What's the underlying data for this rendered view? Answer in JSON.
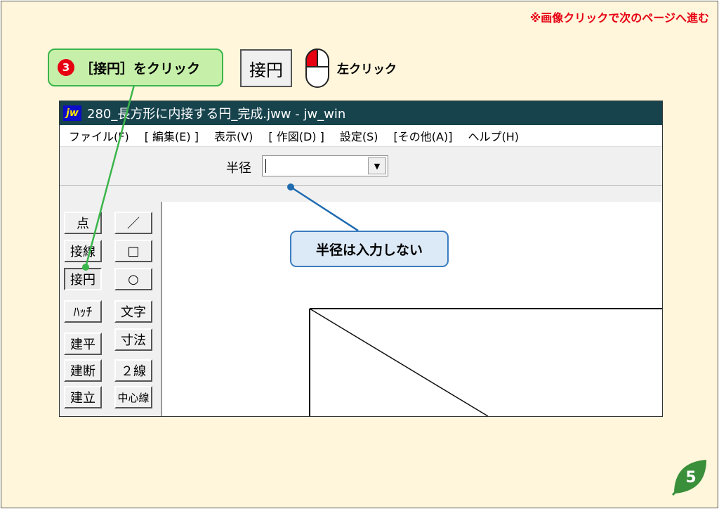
{
  "top_note": "※画像クリックで次のページへ進む",
  "step_callout": {
    "number": "3",
    "text": "［接円］をクリック"
  },
  "demo_button_label": "接円",
  "left_click_label": "左クリック",
  "window": {
    "app_icon": "jw",
    "title": "280_長方形に内接する円_完成.jww - jw_win"
  },
  "menu": [
    "ファイル(F)",
    "[ 編集(E) ]",
    "表示(V)",
    "[ 作図(D) ]",
    "設定(S)",
    "[その他(A)]",
    "ヘルプ(H)"
  ],
  "toolbar": {
    "radius_label": "半径",
    "radius_value": ""
  },
  "tools_col1": [
    "点",
    "接線",
    "接円",
    "ﾊｯﾁ",
    "建平",
    "建断",
    "建立"
  ],
  "tools_col2": [
    "／",
    "□",
    "○",
    "文字",
    "寸法",
    "２線",
    "中心線"
  ],
  "radius_callout": "半径は入力しない",
  "page_number": "5",
  "colors": {
    "background": "#fff6dc",
    "accent_red": "#e60012",
    "green_callout": "#c6f0a9",
    "blue_callout": "#dce9f6",
    "titlebar": "#17434d"
  }
}
